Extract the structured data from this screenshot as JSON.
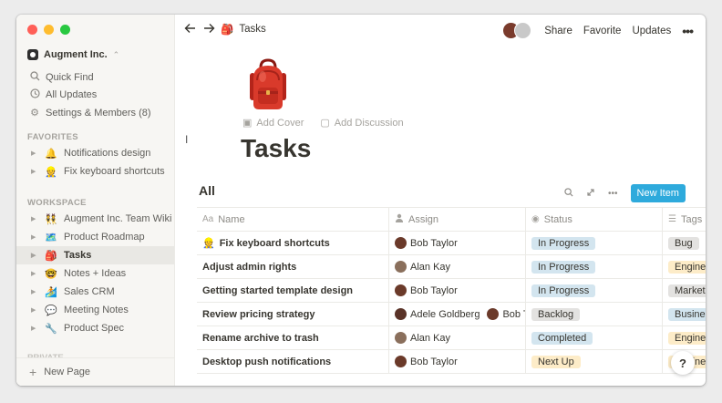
{
  "sidebar": {
    "workspace": "Augment Inc.",
    "links": [
      {
        "icon": "search-icon",
        "label": "Quick Find"
      },
      {
        "icon": "clock-icon",
        "label": "All Updates"
      },
      {
        "icon": "gear-icon",
        "label": "Settings & Members (8)"
      }
    ],
    "favorites_label": "FAVORITES",
    "favorites": [
      {
        "emoji": "🔔",
        "label": "Notifications design"
      },
      {
        "emoji": "👷",
        "label": "Fix keyboard shortcuts"
      }
    ],
    "workspace_label": "WORKSPACE",
    "pages": [
      {
        "emoji": "👯",
        "label": "Augment Inc. Team Wiki"
      },
      {
        "emoji": "🗺️",
        "label": "Product Roadmap"
      },
      {
        "emoji": "🎒",
        "label": "Tasks"
      },
      {
        "emoji": "🤓",
        "label": "Notes + Ideas"
      },
      {
        "emoji": "🏄",
        "label": "Sales CRM"
      },
      {
        "emoji": "💬",
        "label": "Meeting Notes"
      },
      {
        "emoji": "🔧",
        "label": "Product Spec"
      }
    ],
    "private_label": "PRIVATE",
    "new_page": "New Page"
  },
  "topbar": {
    "breadcrumb_emoji": "🎒",
    "breadcrumb": "Tasks",
    "share": "Share",
    "favorite": "Favorite",
    "updates": "Updates",
    "more": "•••"
  },
  "page": {
    "icon": "backpack",
    "add_cover": "Add Cover",
    "add_discussion": "Add Discussion",
    "title": "Tasks"
  },
  "database": {
    "view_name": "All",
    "new_item": "New Item",
    "columns": [
      {
        "icon": "Aa",
        "label": "Name"
      },
      {
        "icon": "👤",
        "label": "Assign"
      },
      {
        "icon": "◉",
        "label": "Status"
      },
      {
        "icon": "☰",
        "label": "Tags"
      }
    ],
    "rows": [
      {
        "emoji": "👷",
        "name": "Fix keyboard shortcuts",
        "assign": [
          "Bob Taylor"
        ],
        "status": "In Progress",
        "tag": "Bug"
      },
      {
        "emoji": "",
        "name": "Adjust admin rights",
        "assign": [
          "Alan Kay"
        ],
        "status": "In Progress",
        "tag": "Engine"
      },
      {
        "emoji": "",
        "name": "Getting started template design",
        "assign": [
          "Bob Taylor"
        ],
        "status": "In Progress",
        "tag": "Market"
      },
      {
        "emoji": "",
        "name": "Review pricing strategy",
        "assign": [
          "Adele Goldberg",
          "Bob T"
        ],
        "status": "Backlog",
        "tag": "Busine"
      },
      {
        "emoji": "",
        "name": "Rename archive to trash",
        "assign": [
          "Alan Kay"
        ],
        "status": "Completed",
        "tag": "Engine"
      },
      {
        "emoji": "",
        "name": "Desktop push notifications",
        "assign": [
          "Bob Taylor"
        ],
        "status": "Next Up",
        "tag": "Engine"
      }
    ]
  },
  "colors": {
    "in_progress": "#d3e5ef",
    "backlog": "#e3e2e0",
    "completed": "#dbeddb",
    "next_up": "#fdecc8",
    "tag_bug": "#e3e2e0",
    "tag_engine": "#fdecc8",
    "tag_market": "#e3e2e0",
    "tag_busine": "#d3e5ef",
    "accent": "#2eaadc"
  },
  "help": "?"
}
